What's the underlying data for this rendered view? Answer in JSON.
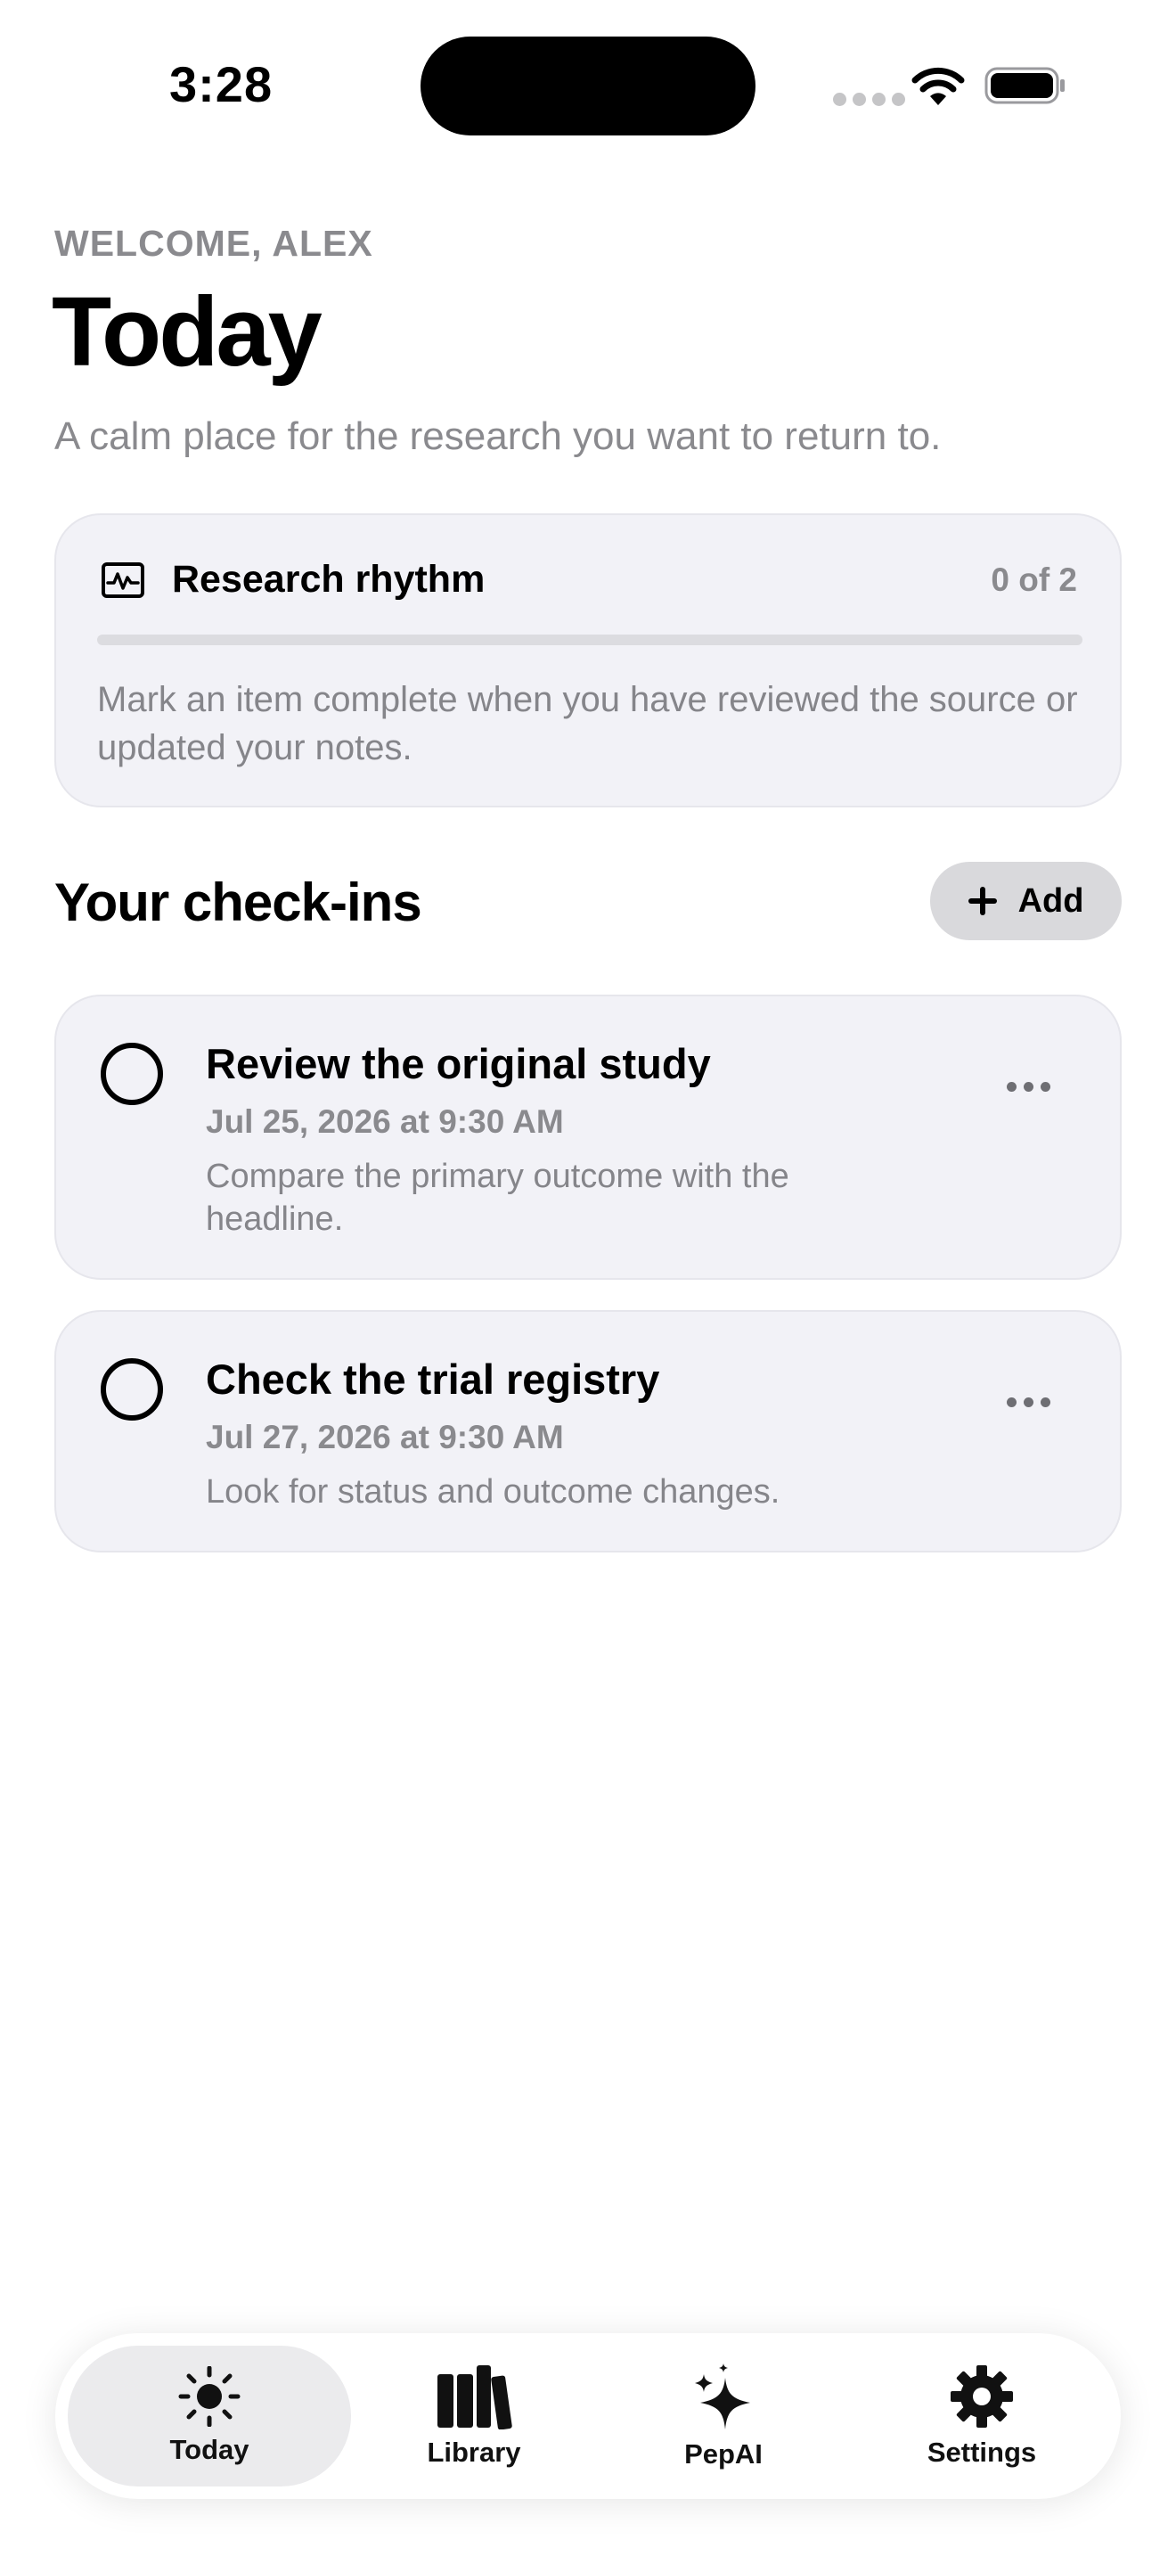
{
  "status_bar": {
    "time": "3:28"
  },
  "header": {
    "welcome": "WELCOME, ALEX",
    "title": "Today",
    "subtitle": "A calm place for the research you want to return to."
  },
  "rhythm": {
    "title": "Research rhythm",
    "count": "0 of 2",
    "progress": 0,
    "description": "Mark an item complete when you have reviewed the source or updated your notes."
  },
  "checkins": {
    "section_title": "Your check-ins",
    "add_label": "Add",
    "items": [
      {
        "title": "Review the original study",
        "date": "Jul 25, 2026 at 9:30 AM",
        "note": "Compare the primary outcome with the headline.",
        "completed": false
      },
      {
        "title": "Check the trial registry",
        "date": "Jul 27, 2026 at 9:30 AM",
        "note": "Look for status and outcome changes.",
        "completed": false
      }
    ]
  },
  "tabs": [
    {
      "label": "Today",
      "icon": "sun-icon",
      "selected": true
    },
    {
      "label": "Library",
      "icon": "books-icon",
      "selected": false
    },
    {
      "label": "PepAI",
      "icon": "sparkles-icon",
      "selected": false
    },
    {
      "label": "Settings",
      "icon": "gear-icon",
      "selected": false
    }
  ]
}
